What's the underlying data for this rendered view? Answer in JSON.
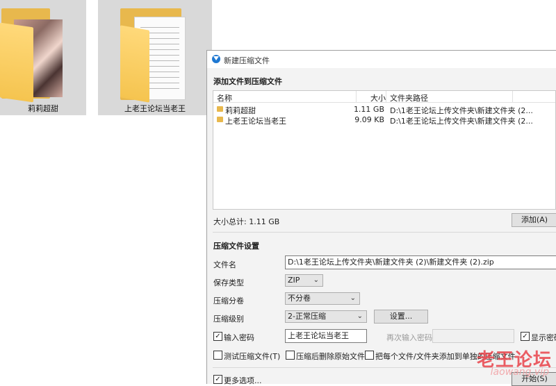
{
  "desktop": {
    "folders": [
      {
        "label": "莉莉超甜"
      },
      {
        "label": "上老王论坛当老王"
      }
    ]
  },
  "dialog": {
    "title": "新建压缩文件",
    "add_section_title": "添加文件到压缩文件",
    "columns": {
      "name": "名称",
      "size": "大小",
      "path": "文件夹路径"
    },
    "files": [
      {
        "name": "莉莉超甜",
        "size": "1.11 GB",
        "path": "D:\\1老王论坛上传文件夹\\新建文件夹 (2..."
      },
      {
        "name": "上老王论坛当老王",
        "size": "9.09 KB",
        "path": "D:\\1老王论坛上传文件夹\\新建文件夹 (2..."
      }
    ],
    "total_size": "大小总计: 1.11 GB",
    "add_button": "添加(A)",
    "settings_title": "压缩文件设置",
    "labels": {
      "filename": "文件名",
      "save_type": "保存类型",
      "split": "压缩分卷",
      "level": "压缩级别"
    },
    "filename_value": "D:\\1老王论坛上传文件夹\\新建文件夹 (2)\\新建文件夹 (2).zip",
    "save_type_value": "ZIP",
    "split_value": "不分卷",
    "level_value": "2-正常压缩",
    "settings_button": "设置...",
    "password_checkbox": "输入密码",
    "password_value": "上老王论坛当老王",
    "reenter_label": "再次输入密码",
    "show_password": "显示密码",
    "test_archive": "测试压缩文件(T)",
    "delete_after": "压缩后删除原始文件",
    "each_separate": "把每个文件/文件夹添加到单独的压缩文件",
    "more_options": "更多选项...",
    "start_button": "开始(S)"
  },
  "watermark": {
    "text": "老王论坛",
    "url": "laowang.vip"
  }
}
